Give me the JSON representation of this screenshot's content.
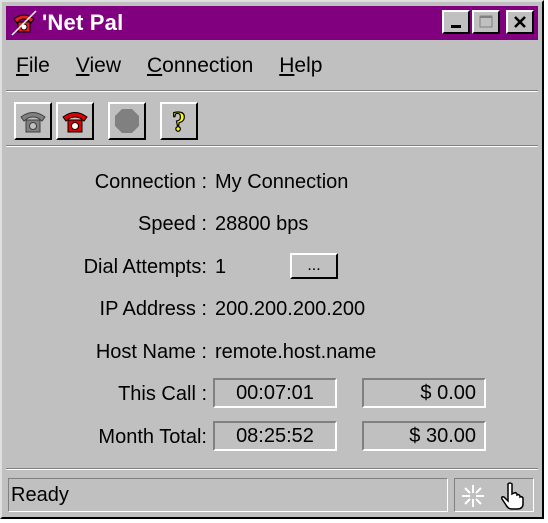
{
  "window": {
    "title": "'Net Pal"
  },
  "menu": [
    {
      "accel": "F",
      "rest": "ile"
    },
    {
      "accel": "V",
      "rest": "iew"
    },
    {
      "accel": "C",
      "rest": "onnection"
    },
    {
      "accel": "H",
      "rest": "elp"
    }
  ],
  "toolbar": {
    "icons": [
      "connect-phone-icon",
      "disconnect-phone-icon",
      "stop-icon",
      "help-question-icon"
    ]
  },
  "fields": {
    "connection_label": "Connection :",
    "connection_value": "My Connection",
    "speed_label": "Speed :",
    "speed_value": "28800 bps",
    "dial_attempts_label": "Dial Attempts:",
    "dial_attempts_value": "1",
    "dial_button_label": "...",
    "ip_label": "IP Address :",
    "ip_value": "200.200.200.200",
    "host_label": "Host Name :",
    "host_value": "remote.host.name",
    "this_call_label": "This Call :",
    "this_call_time": "00:07:01",
    "this_call_cost": "$ 0.00",
    "month_total_label": "Month Total:",
    "month_total_time": "08:25:52",
    "month_total_cost": "$ 30.00"
  },
  "status": {
    "text": "Ready"
  },
  "colors": {
    "titlebar": "#800080",
    "face": "#c0c0c0"
  }
}
